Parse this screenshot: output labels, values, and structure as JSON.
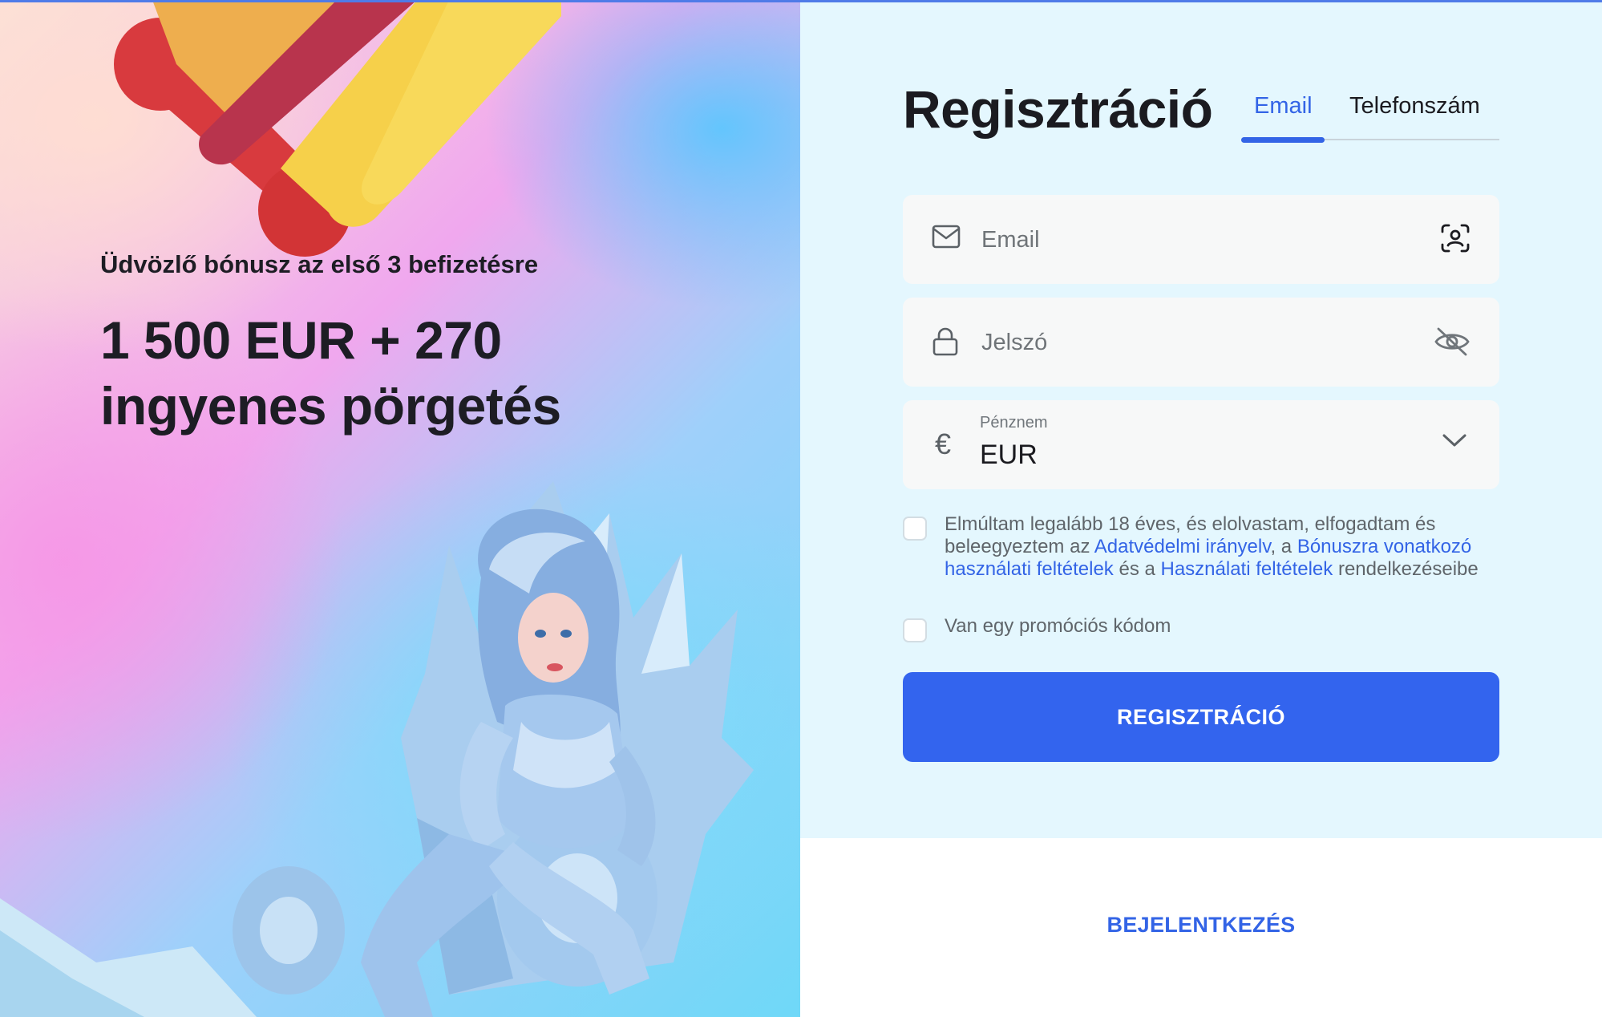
{
  "promo": {
    "subtitle": "Üdvözlő bónusz az első 3 befizetésre",
    "headline": "1 500 EUR + 270 ingyenes pörgetés"
  },
  "register": {
    "title": "Regisztráció",
    "tabs": [
      {
        "label": "Email",
        "active": true
      },
      {
        "label": "Telefonszám",
        "active": false
      }
    ],
    "email_field": {
      "placeholder": "Email",
      "value": "",
      "leading_icon": "mail-icon",
      "trailing_icon": "face-scan-icon"
    },
    "password_field": {
      "placeholder": "Jelszó",
      "value": "",
      "leading_icon": "lock-icon",
      "trailing_icon": "eye-off-icon"
    },
    "currency_field": {
      "label": "Pénznem",
      "value": "EUR",
      "leading_icon": "euro-icon",
      "trailing_icon": "chevron-down-icon"
    },
    "terms_check": {
      "checked": false,
      "text_1": "Elmúltam legalább 18 éves, és elolvastam, elfogadtam és beleegyeztem az ",
      "link_privacy": "Adatvédelmi irányelv",
      "text_2": ", a ",
      "link_bonus": "Bónuszra vonatkozó használati feltételek",
      "text_3": " és a ",
      "link_terms": "Használati feltételek",
      "text_4": " rendelkezéseibe"
    },
    "promo_check": {
      "checked": false,
      "label": "Van egy promóciós kódom"
    },
    "submit_label": "REGISZTRÁCIÓ",
    "login_label": "BEJELENTKEZÉS"
  },
  "colors": {
    "accent": "#3364EE",
    "panel_background": "#E4F7FE",
    "title_text": "#1B1B20"
  }
}
